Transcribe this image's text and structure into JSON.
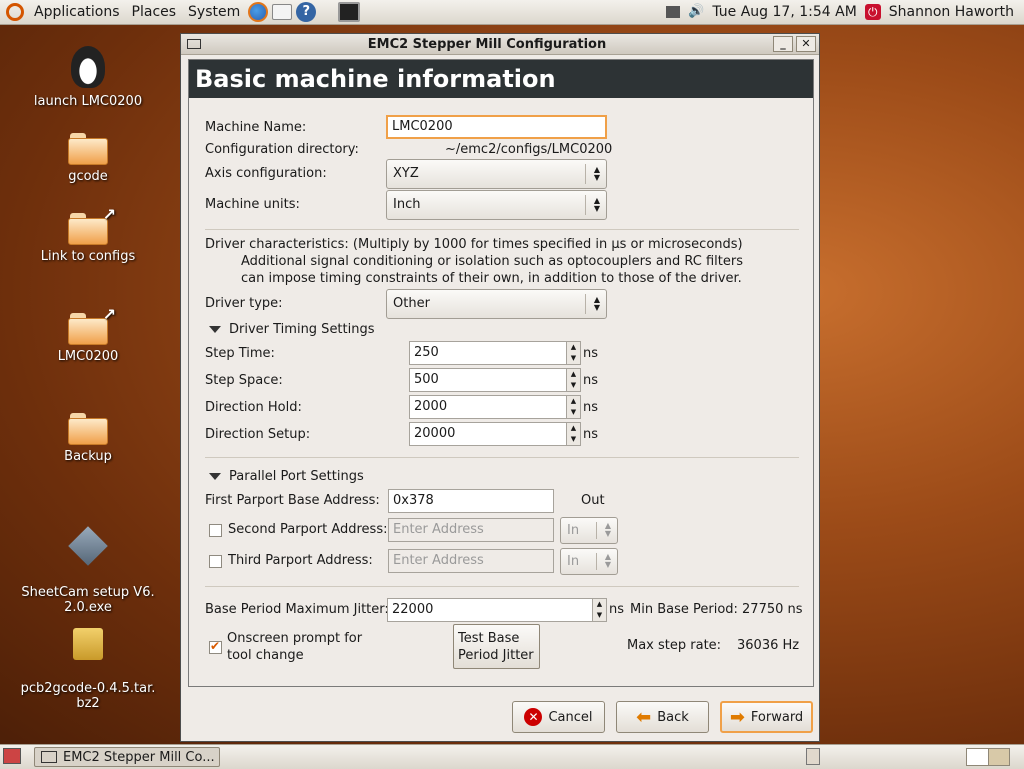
{
  "top_panel": {
    "menus": [
      "Applications",
      "Places",
      "System"
    ],
    "clock": "Tue Aug 17,  1:54 AM",
    "user": "Shannon Haworth"
  },
  "desktop_icons": [
    {
      "label": "launch LMC0200",
      "icon": "penguin-icon"
    },
    {
      "label": "gcode",
      "icon": "folder-icon"
    },
    {
      "label": "Link to configs",
      "icon": "folder-link-icon"
    },
    {
      "label": "LMC0200",
      "icon": "folder-link-icon"
    },
    {
      "label": "Backup",
      "icon": "folder-icon"
    },
    {
      "label": "SheetCam setup V6.\n2.0.exe",
      "icon": "exe-icon"
    },
    {
      "label": "pcb2gcode-0.4.5.tar.\nbz2",
      "icon": "archive-icon"
    }
  ],
  "window": {
    "title": "EMC2 Stepper Mill Configuration",
    "header": "Basic machine information",
    "machine_name_label": "Machine Name:",
    "machine_name": "LMC0200",
    "config_dir_label": "Configuration directory:",
    "config_dir": "~/emc2/configs/LMC0200",
    "axis_label": "Axis configuration:",
    "axis_value": "XYZ",
    "units_label": "Machine units:",
    "units_value": "Inch",
    "driver_char_line1": "Driver characteristics: (Multiply by 1000 for times specified in µs or microseconds)",
    "driver_char_line2": "Additional signal conditioning or isolation such as optocouplers and RC filters",
    "driver_char_line3": "can impose timing constraints of their own, in addition to those of the driver.",
    "driver_type_label": "Driver type:",
    "driver_type_value": "Other",
    "timing_expander": "Driver Timing Settings",
    "timing": [
      {
        "label": "Step Time:",
        "value": "250",
        "unit": "ns"
      },
      {
        "label": "Step Space:",
        "value": "500",
        "unit": "ns"
      },
      {
        "label": "Direction Hold:",
        "value": "2000",
        "unit": "ns"
      },
      {
        "label": "Direction Setup:",
        "value": "20000",
        "unit": "ns"
      }
    ],
    "parport_expander": "Parallel Port Settings",
    "parport1_label": "First Parport Base Address:",
    "parport1_value": "0x378",
    "parport1_dir": "Out",
    "parport2_label": "Second Parport Address:",
    "parport2_placeholder": "Enter Address",
    "parport2_dir": "In",
    "parport3_label": "Third Parport Address:",
    "parport3_placeholder": "Enter Address",
    "parport3_dir": "In",
    "jitter_label": "Base Period Maximum Jitter:",
    "jitter_value": "22000",
    "jitter_unit": "ns",
    "min_base_period": "Min Base Period: 27750 ns",
    "onscreen_prompt": "Onscreen prompt for\ntool change",
    "test_jitter_button": "Test Base\nPeriod Jitter",
    "max_step_rate_label": "Max step rate:",
    "max_step_rate_value": "36036 Hz",
    "cancel": "Cancel",
    "back": "Back",
    "forward": "Forward"
  },
  "bottom_panel": {
    "task": "EMC2 Stepper Mill Co..."
  }
}
